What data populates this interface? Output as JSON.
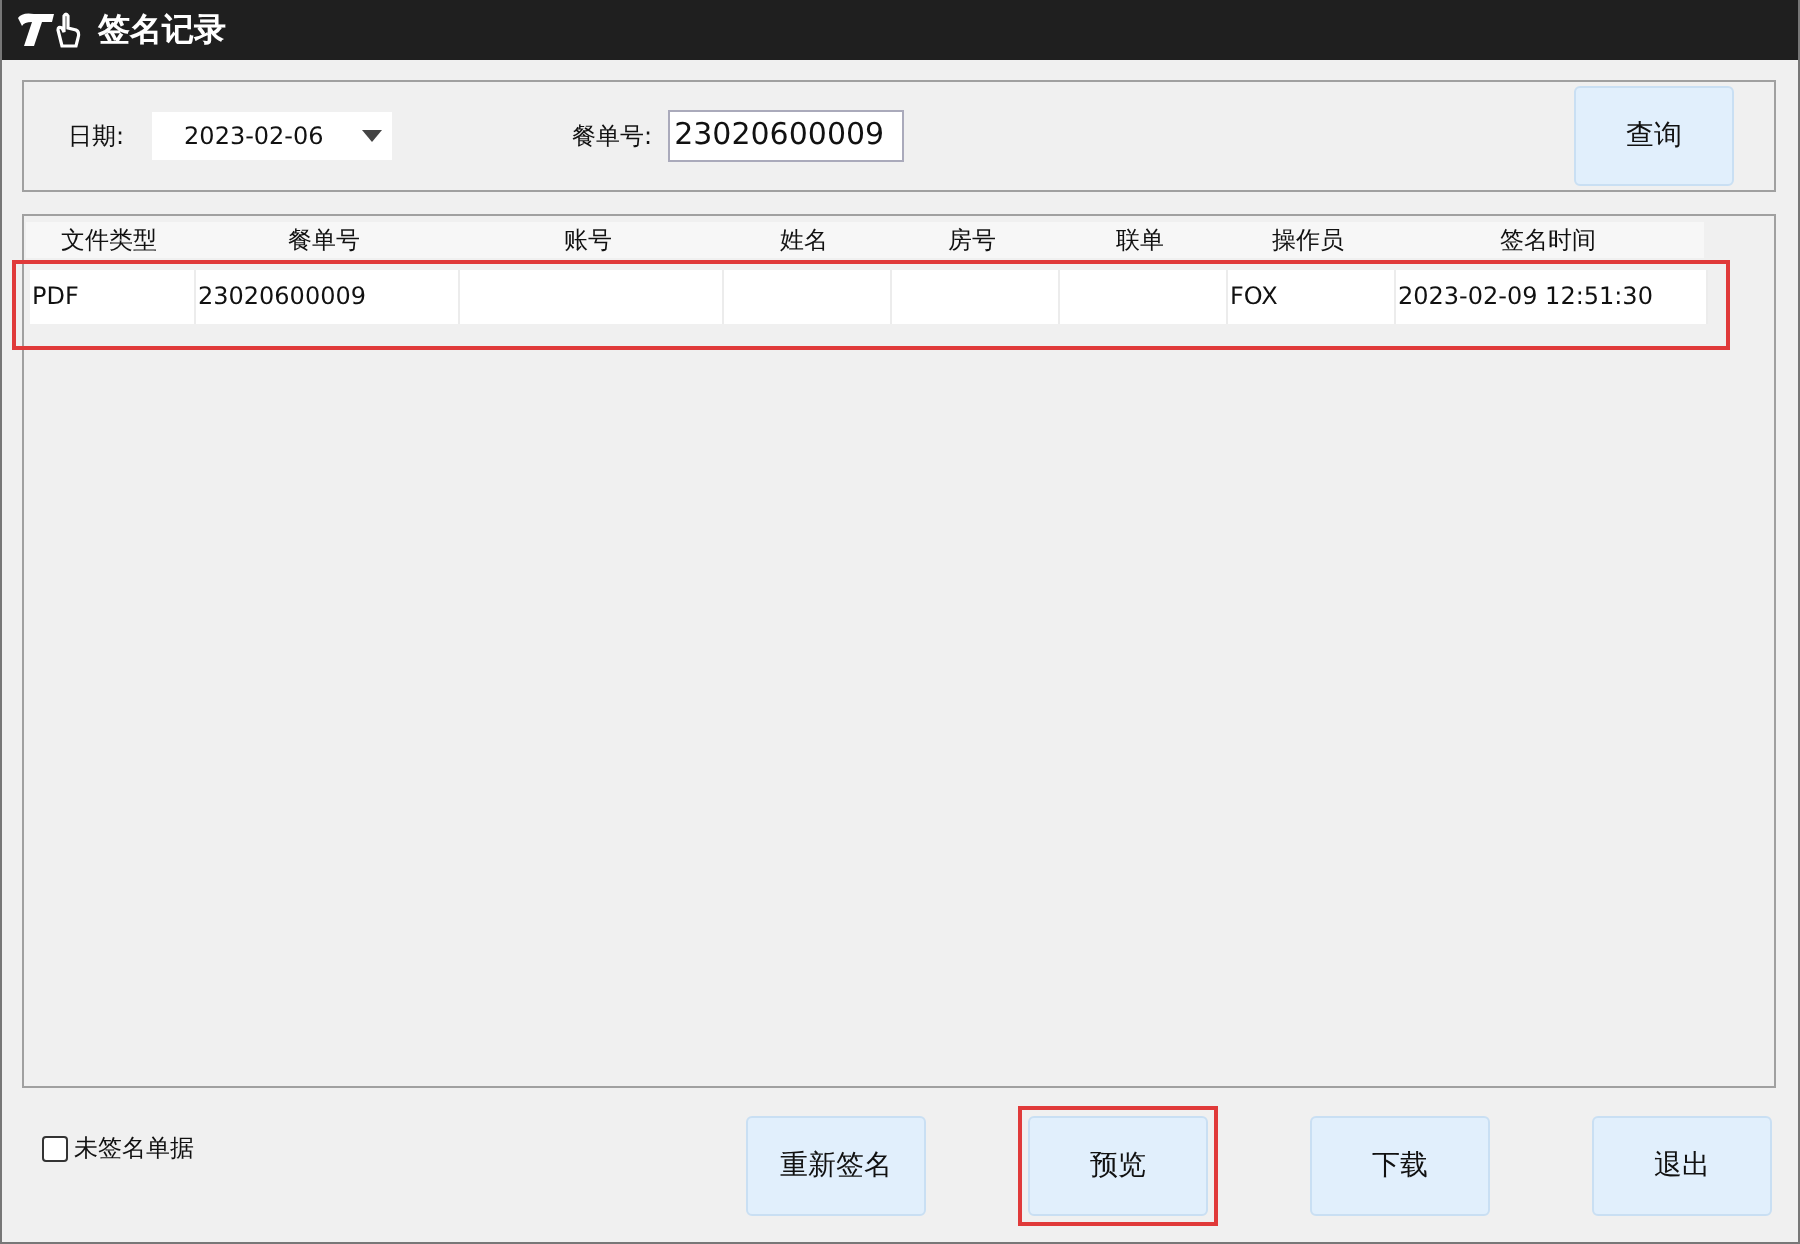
{
  "window": {
    "title": "签名记录"
  },
  "filters": {
    "date_label": "日期:",
    "date_value": "2023-02-06",
    "order_label": "餐单号:",
    "order_value": "23020600009",
    "query_button": "查询"
  },
  "table": {
    "columns": [
      "文件类型",
      "餐单号",
      "账号",
      "姓名",
      "房号",
      "联单",
      "操作员",
      "签名时间"
    ],
    "rows": [
      {
        "cells": [
          "PDF",
          "23020600009",
          "",
          "",
          "",
          "",
          "FOX",
          "2023-02-09 12:51:30"
        ],
        "highlighted": true
      }
    ]
  },
  "unsigned_only": {
    "label": "未签名单据",
    "checked": false
  },
  "buttons": [
    {
      "label": "重新签名",
      "highlighted": false
    },
    {
      "label": "预览",
      "highlighted": true
    },
    {
      "label": "下载",
      "highlighted": false
    },
    {
      "label": "退出",
      "highlighted": false
    }
  ]
}
